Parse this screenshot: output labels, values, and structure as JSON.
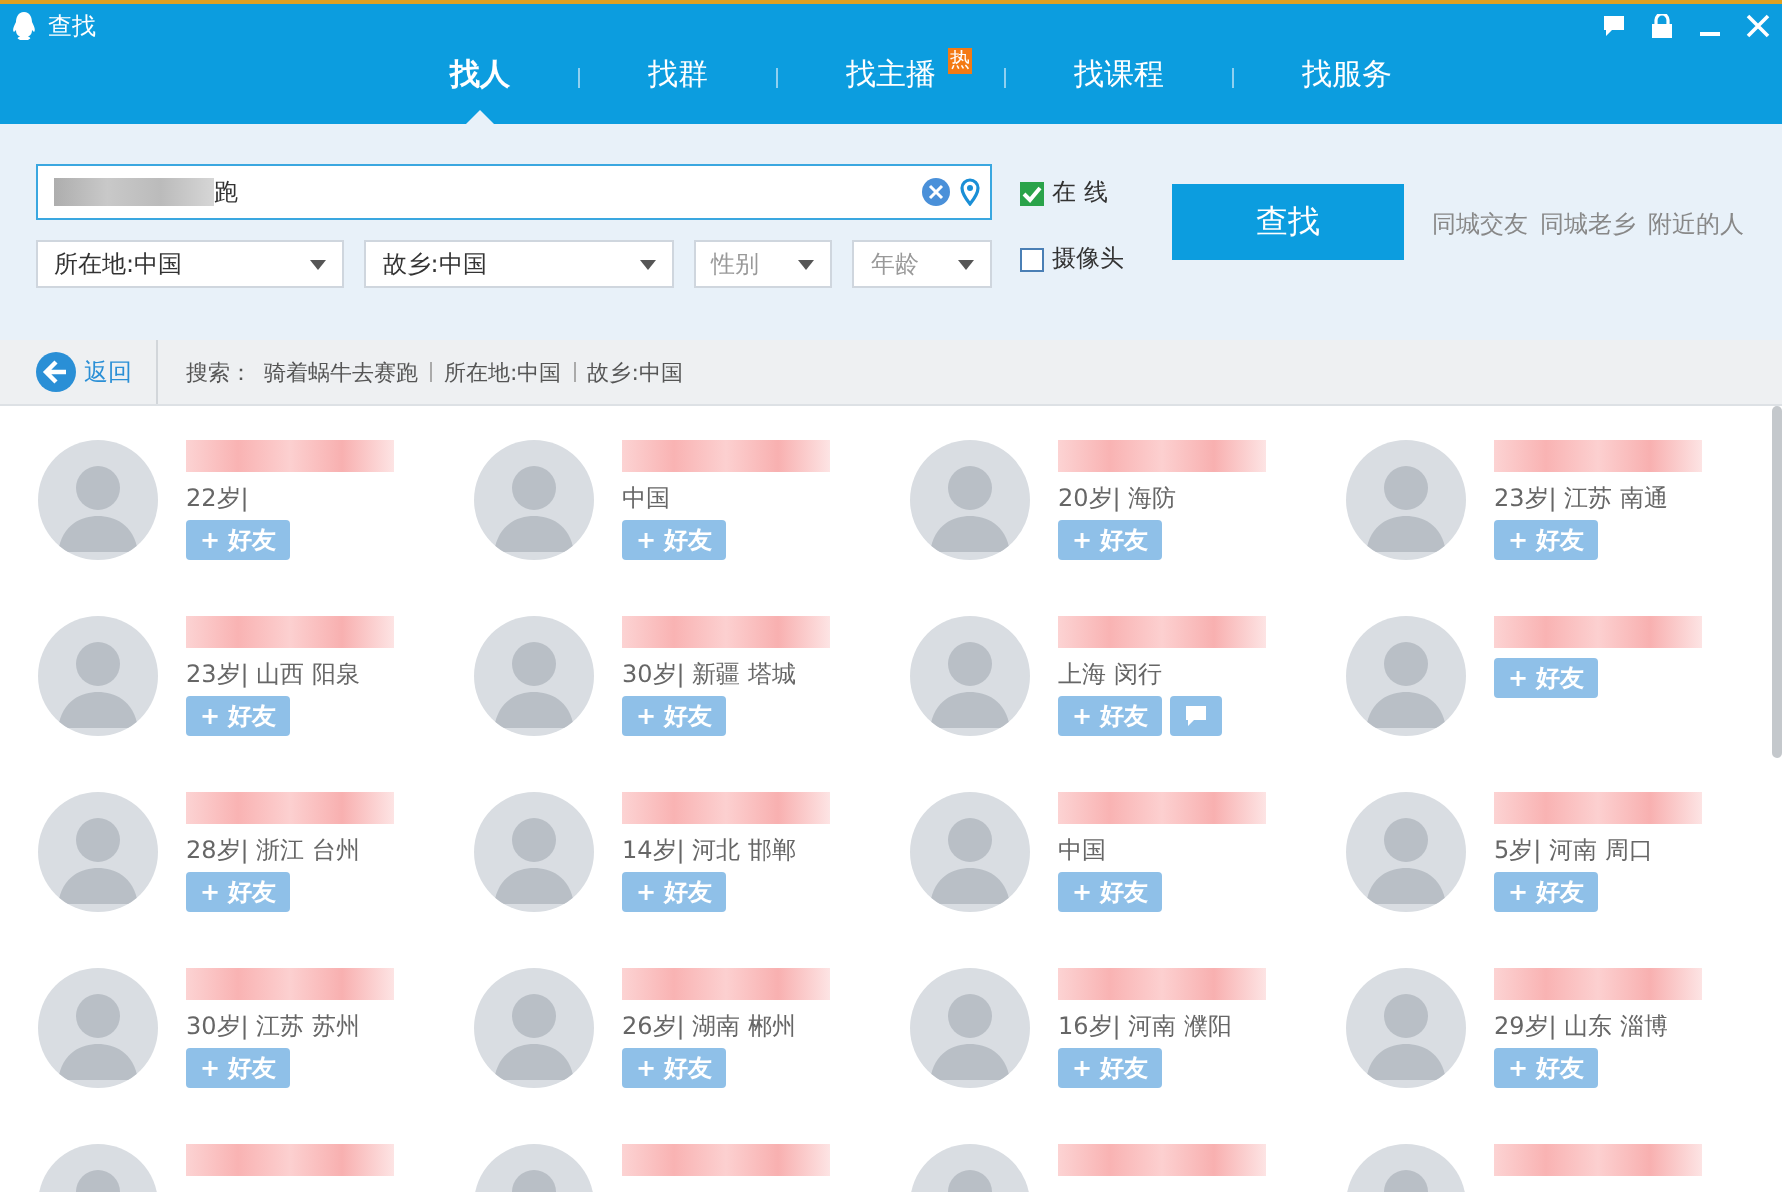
{
  "window": {
    "title": "查找"
  },
  "tabs": [
    {
      "label": "找人",
      "selected": true
    },
    {
      "label": "找群",
      "selected": false
    },
    {
      "label": "找主播",
      "selected": false,
      "badge": "热"
    },
    {
      "label": "找课程",
      "selected": false
    },
    {
      "label": "找服务",
      "selected": false
    }
  ],
  "search": {
    "value": "跑",
    "online": {
      "label": "在 线",
      "checked": true
    },
    "camera": {
      "label": "摄像头",
      "checked": false
    },
    "filters": [
      {
        "label": "所在地:中国",
        "kind": "wide"
      },
      {
        "label": "故乡:中国",
        "kind": "wide"
      },
      {
        "label": "性别",
        "kind": "placeholder"
      },
      {
        "label": "年龄",
        "kind": "placeholder"
      }
    ],
    "button": "查找",
    "links": [
      "同城交友",
      "同城老乡",
      "附近的人"
    ]
  },
  "breadcrumb": {
    "back": "返回",
    "prefix": "搜索：",
    "terms": [
      "骑着蜗牛去赛跑",
      "所在地:中国",
      "故乡:中国"
    ]
  },
  "results": [
    {
      "info": "22岁|",
      "add": "+ 好友",
      "chat": false
    },
    {
      "info": "中国",
      "add": "+ 好友",
      "chat": false
    },
    {
      "info": "20岁| 海防",
      "add": "+ 好友",
      "chat": false
    },
    {
      "info": "23岁| 江苏 南通",
      "add": "+ 好友",
      "chat": false
    },
    {
      "info": "23岁| 山西 阳泉",
      "add": "+ 好友",
      "chat": false
    },
    {
      "info": "30岁| 新疆 塔城",
      "add": "+ 好友",
      "chat": false
    },
    {
      "info": "上海 闵行",
      "add": "+ 好友",
      "chat": true
    },
    {
      "add": "+ 好友",
      "chat": false
    },
    {
      "info": "28岁| 浙江 台州",
      "add": "+ 好友",
      "chat": false
    },
    {
      "info": "14岁| 河北 邯郸",
      "add": "+ 好友",
      "chat": false
    },
    {
      "info": "中国",
      "add": "+ 好友",
      "chat": false
    },
    {
      "info": "5岁| 河南 周口",
      "add": "+ 好友",
      "chat": false
    },
    {
      "info": "30岁| 江苏 苏州",
      "add": "+ 好友",
      "chat": false
    },
    {
      "info": "26岁| 湖南 郴州",
      "add": "+ 好友",
      "chat": false
    },
    {
      "info": "16岁| 河南 濮阳",
      "add": "+ 好友",
      "chat": false
    },
    {
      "info": "29岁| 山东 淄博",
      "add": "+ 好友",
      "chat": false
    }
  ]
}
